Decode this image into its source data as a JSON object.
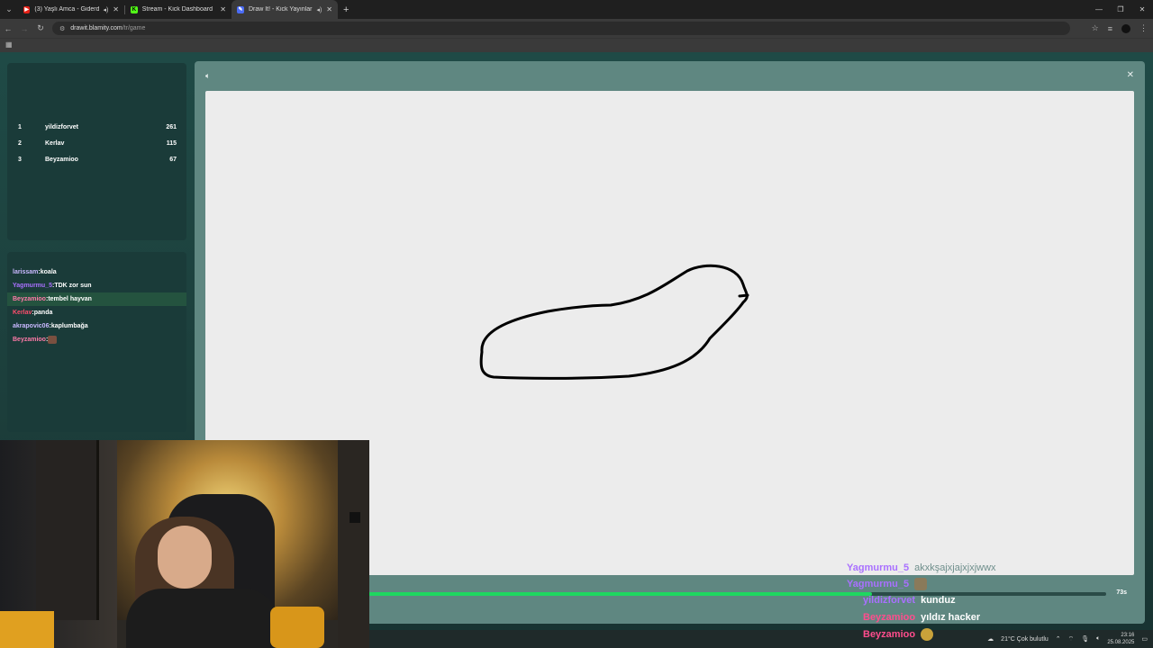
{
  "browser": {
    "tabs": [
      {
        "title": "(3) Yaşlı Amca - Giderdi Ho",
        "favicon": "youtube-icon",
        "color": "#e62117",
        "audio": true
      },
      {
        "title": "Stream - Kick Dashboard",
        "favicon": "kick-icon",
        "color": "#53fc18",
        "audio": false
      },
      {
        "title": "Draw It! - Kick Yayınları İçin",
        "favicon": "drawit-icon",
        "color": "#4b6cf5",
        "audio": true,
        "active": true
      }
    ],
    "address": {
      "host": "drawit.blamity.com",
      "path": "/tr/game"
    }
  },
  "leaderboard": [
    {
      "rank": "1",
      "name": "yildizforvet",
      "score": "261"
    },
    {
      "rank": "2",
      "name": "Kerlav",
      "score": "115"
    },
    {
      "rank": "3",
      "name": "Beyzamioo",
      "score": "67"
    }
  ],
  "chat": [
    {
      "user": "larissam",
      "message": "koala",
      "color": "#c9b8ff",
      "highlight": false
    },
    {
      "user": "Yagmurmu_5",
      "message": "TDK zor sun",
      "color": "#a970ff",
      "highlight": false
    },
    {
      "user": "Beyzamioo",
      "message": "tembel hayvan",
      "color": "#ff7aa8",
      "highlight": true
    },
    {
      "user": "Kerlav",
      "message": "panda",
      "color": "#ff4d6d",
      "highlight": false
    },
    {
      "user": "akrapovic06",
      "message": "kaplumbağa",
      "color": "#c9b8ff",
      "highlight": false
    },
    {
      "user": "Beyzamioo",
      "message": "",
      "color": "#ff7aa8",
      "highlight": false
    }
  ],
  "game": {
    "timer_label": "73s",
    "timer_fraction": 0.74
  },
  "overlay_chat": [
    {
      "user": "Yagmurmu_5",
      "message": "akxkşajxjajxjxjwwx",
      "user_color": "#a970ff",
      "message_color": "#6f8f8c"
    },
    {
      "user": "Yagmurmu_5",
      "message": "",
      "user_color": "#a970ff",
      "message_color": "#ffffff",
      "emote": true
    },
    {
      "user": "yildizforvet",
      "message": "kunduz",
      "user_color": "#a970ff",
      "message_color": "#ffffff"
    },
    {
      "user": "Beyzamioo",
      "message": "yıldız hacker",
      "user_color": "#ff4d8d",
      "message_color": "#ffffff"
    },
    {
      "user": "Beyzamioo",
      "message": "",
      "user_color": "#ff4d8d",
      "message_color": "#ffffff",
      "emote": true
    }
  ],
  "taskbar": {
    "weather": "21°C  Çok bulutlu",
    "time": "23:16",
    "date": "25.08.2025"
  }
}
